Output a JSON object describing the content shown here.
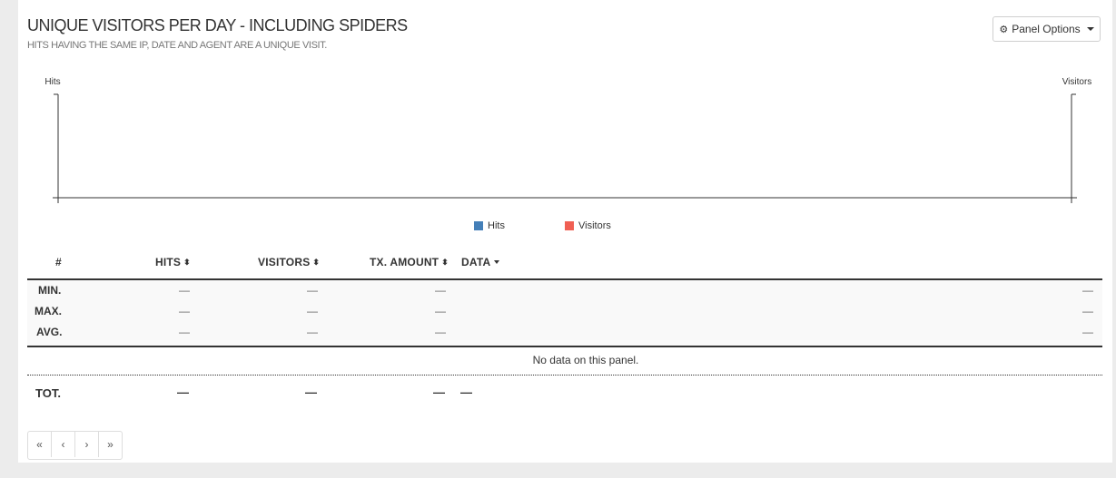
{
  "panel": {
    "title": "UNIQUE VISITORS PER DAY - INCLUDING SPIDERS",
    "subtitle": "HITS HAVING THE SAME IP, DATE AND AGENT ARE A UNIQUE VISIT.",
    "options_label": "Panel Options"
  },
  "chart_data": {
    "type": "bar",
    "categories": [],
    "series": [
      {
        "name": "Hits",
        "values": [],
        "color": "#447fb8"
      },
      {
        "name": "Visitors",
        "values": [],
        "color": "#f05f53"
      }
    ],
    "title": "",
    "ylabel": "Hits",
    "y2label": "Visitors",
    "legend": "bottom"
  },
  "table": {
    "headers": {
      "index": "#",
      "hits": "HITS",
      "visitors": "VISITORS",
      "tx_amount": "TX. AMOUNT",
      "data": "DATA"
    },
    "sort_icon": "⬍",
    "rows": [
      {
        "label": "MIN.",
        "hits": "—",
        "visitors": "—",
        "tx_amount": "—",
        "data": "—"
      },
      {
        "label": "MAX.",
        "hits": "—",
        "visitors": "—",
        "tx_amount": "—",
        "data": "—"
      },
      {
        "label": "AVG.",
        "hits": "—",
        "visitors": "—",
        "tx_amount": "—",
        "data": "—"
      }
    ],
    "no_data": "No data on this panel.",
    "total": {
      "label": "TOT.",
      "hits": "—",
      "visitors": "—",
      "tx_amount": "—",
      "data": "—"
    }
  },
  "pager": {
    "first": "«",
    "prev": "‹",
    "next": "›",
    "last": "»"
  },
  "icons": {
    "options": "gear-icon"
  }
}
